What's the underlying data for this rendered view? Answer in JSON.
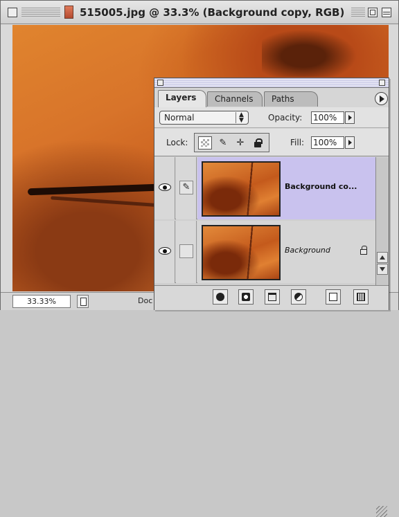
{
  "window": {
    "title": "515005.jpg @ 33.3% (Background copy, RGB)"
  },
  "status": {
    "zoom": "33.33%",
    "doc_info": "Doc"
  },
  "layers_palette": {
    "tabs": [
      {
        "label": "Layers",
        "active": true
      },
      {
        "label": "Channels",
        "active": false
      },
      {
        "label": "Paths",
        "active": false
      }
    ],
    "blend_mode": "Normal",
    "opacity_label": "Opacity:",
    "opacity_value": "100%",
    "lock_label": "Lock:",
    "fill_label": "Fill:",
    "fill_value": "100%",
    "layers": [
      {
        "name": "Background co...",
        "selected": true,
        "visible": true,
        "brush_linked": true
      },
      {
        "name": "Background",
        "selected": false,
        "visible": true,
        "locked": true
      }
    ],
    "bottom_buttons": [
      "layer-style",
      "layer-mask",
      "new-set",
      "adjustment-layer",
      "new-layer",
      "delete-layer"
    ]
  },
  "colors": {
    "selected_layer_bg": "#c9c2ee",
    "canvas_rock": "#d8742a"
  }
}
